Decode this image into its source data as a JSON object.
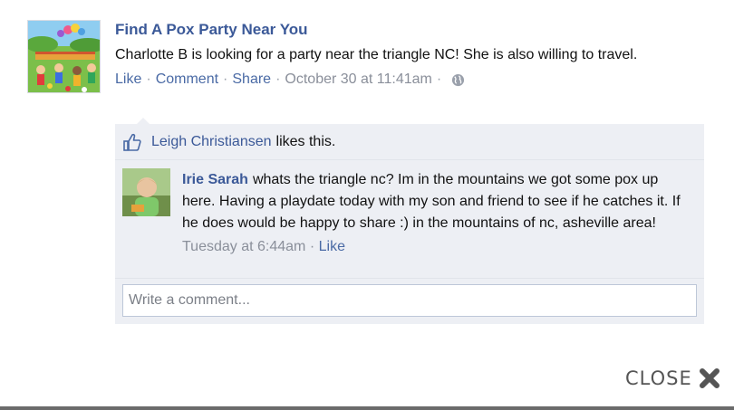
{
  "post": {
    "page_name": "Find A Pox Party Near You",
    "text": "Charlotte B is looking for a party near the triangle NC! She is also willing to travel.",
    "actions": {
      "like": "Like",
      "comment": "Comment",
      "share": "Share"
    },
    "separator": "·",
    "timestamp": "October 30 at 11:41am",
    "privacy_icon": "globe-icon"
  },
  "likes": {
    "icon": "thumbs-up-icon",
    "liker": "Leigh Christiansen",
    "suffix": "likes this."
  },
  "comment": {
    "author": "Irie Sarah",
    "text": "whats the triangle nc? Im in the mountains we got some pox up here. Having a playdate today with my son and friend to see if he catches it. If he does would be happy to share :) in the mountains of nc, asheville area!",
    "time": "Tuesday at 6:44am",
    "separator": "·",
    "like": "Like"
  },
  "write_comment": {
    "placeholder": "Write a comment..."
  },
  "close": {
    "label": "CLOSE",
    "icon": "close-x-icon"
  },
  "colors": {
    "link": "#3b5998",
    "panel": "#edeff4",
    "meta": "#8a8f9a"
  }
}
